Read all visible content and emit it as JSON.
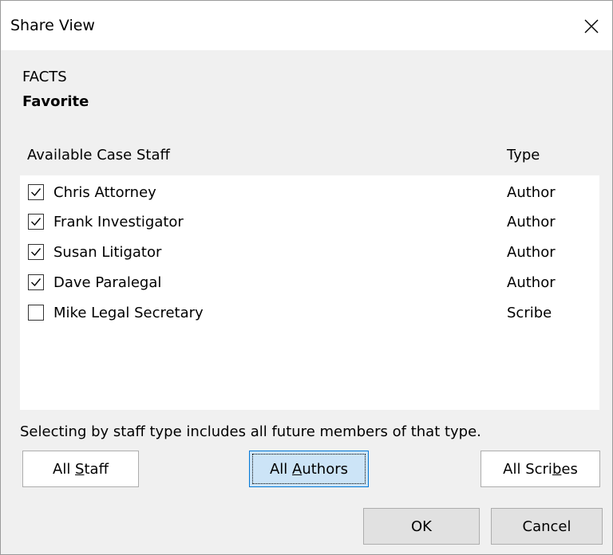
{
  "window": {
    "title": "Share View"
  },
  "view": {
    "case_name": "FACTS",
    "view_name": "Favorite"
  },
  "staff_list": {
    "header_name": "Available Case Staff",
    "header_type": "Type",
    "rows": [
      {
        "name": "Chris Attorney",
        "type": "Author",
        "checked": true
      },
      {
        "name": "Frank Investigator",
        "type": "Author",
        "checked": true
      },
      {
        "name": "Susan Litigator",
        "type": "Author",
        "checked": true
      },
      {
        "name": "Dave Paralegal",
        "type": "Author",
        "checked": true
      },
      {
        "name": "Mike Legal Secretary",
        "type": "Scribe",
        "checked": false
      }
    ]
  },
  "hint_text": "Selecting by staff type includes all future members of that type.",
  "buttons": {
    "all_staff_pre": "All ",
    "all_staff_ul": "S",
    "all_staff_post": "taff",
    "all_authors_pre": "All ",
    "all_authors_ul": "A",
    "all_authors_post": "uthors",
    "all_scribes_pre": "All Scri",
    "all_scribes_ul": "b",
    "all_scribes_post": "es",
    "ok": "OK",
    "cancel": "Cancel"
  },
  "icons": {
    "close": "close-icon",
    "check": "checkmark-icon"
  }
}
